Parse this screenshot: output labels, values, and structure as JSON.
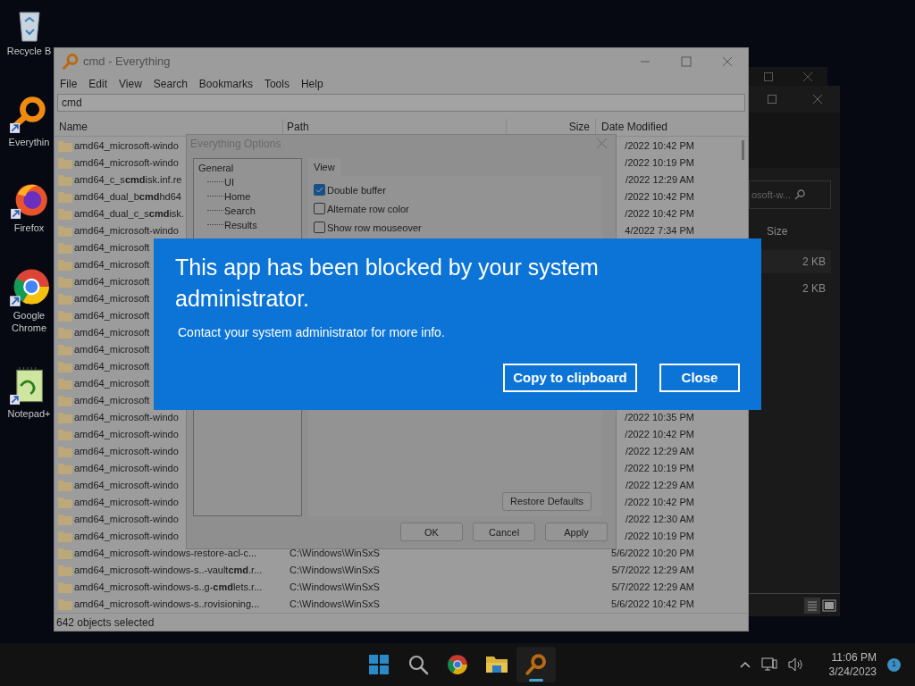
{
  "desktop_icons": [
    {
      "kind": "recycle",
      "label": "Recycle B"
    },
    {
      "kind": "everything",
      "label": "Everythin"
    },
    {
      "kind": "firefox",
      "label": "Firefox"
    },
    {
      "kind": "chrome",
      "label": "Google Chrome"
    },
    {
      "kind": "notepad",
      "label": "Notepad+"
    }
  ],
  "main_window": {
    "title": "cmd - Everything",
    "menu": [
      "File",
      "Edit",
      "View",
      "Search",
      "Bookmarks",
      "Tools",
      "Help"
    ],
    "search": {
      "value": "cmd"
    },
    "columns": [
      "Name",
      "Path",
      "Size",
      "Date Modified"
    ],
    "rows": [
      {
        "name": "amd64_microsoft-windo",
        "date": "/2022 10:42 PM"
      },
      {
        "name": "amd64_microsoft-windo",
        "date": "/2022 10:19 PM"
      },
      {
        "name": "amd64_c_s**cmd**isk.inf.re",
        "date": "/2022 12:29 AM"
      },
      {
        "name": "amd64_dual_b**cmd**hd64",
        "date": "/2022 10:42 PM"
      },
      {
        "name": "amd64_dual_c_s**cmd**isk.",
        "date": "/2022 10:42 PM"
      },
      {
        "name": "amd64_microsoft-windo",
        "date": "4/2022 7:34 PM"
      },
      {
        "name": "amd64_microsoft"
      },
      {
        "name": "amd64_microsoft"
      },
      {
        "name": "amd64_microsoft"
      },
      {
        "name": "amd64_microsoft"
      },
      {
        "name": "amd64_microsoft"
      },
      {
        "name": "amd64_microsoft"
      },
      {
        "name": "amd64_microsoft"
      },
      {
        "name": "amd64_microsoft"
      },
      {
        "name": "amd64_microsoft"
      },
      {
        "name": "amd64_microsoft"
      },
      {
        "name": "amd64_microsoft-windo",
        "date": "/2022 10:35 PM"
      },
      {
        "name": "amd64_microsoft-windo",
        "date": "/2022 10:42 PM"
      },
      {
        "name": "amd64_microsoft-windo",
        "date": "/2022 12:29 AM"
      },
      {
        "name": "amd64_microsoft-windo",
        "date": "/2022 10:19 PM"
      },
      {
        "name": "amd64_microsoft-windo",
        "date": "/2022 12:29 AM"
      },
      {
        "name": "amd64_microsoft-windo",
        "date": "/2022 10:42 PM"
      },
      {
        "name": "amd64_microsoft-windo",
        "date": "/2022 12:30 AM"
      },
      {
        "name": "amd64_microsoft-windo",
        "date": "/2022 10:19 PM"
      },
      {
        "name": "amd64_microsoft-windows-restore-acl-c...",
        "path": "C:\\Windows\\WinSxS",
        "date": "5/6/2022 10:20 PM"
      },
      {
        "name": "amd64_microsoft-windows-s..-vault**cmd**.r...",
        "path": "C:\\Windows\\WinSxS",
        "date": "5/7/2022 12:29 AM"
      },
      {
        "name": "amd64_microsoft-windows-s..g-**cmd**lets.r...",
        "path": "C:\\Windows\\WinSxS",
        "date": "5/7/2022 12:29 AM"
      },
      {
        "name": "amd64_microsoft-windows-s..rovisioning...",
        "path": "C:\\Windows\\WinSxS",
        "date": "5/6/2022 10:42 PM"
      }
    ],
    "status_bar": "642 objects selected"
  },
  "options_dialog": {
    "title": "Everything Options",
    "tree": [
      {
        "label": "General",
        "children": [
          {
            "label": "UI"
          },
          {
            "label": "Home"
          },
          {
            "label": "Search"
          },
          {
            "label": "Results"
          }
        ]
      }
    ],
    "tab": "View",
    "view_options": [
      {
        "label": "Double buffer",
        "checked": true
      },
      {
        "label": "Alternate row color",
        "checked": false
      },
      {
        "label": "Show row mouseover",
        "checked": false
      }
    ],
    "restore_button": "Restore Defaults",
    "buttons": [
      "OK",
      "Cancel",
      "Apply"
    ]
  },
  "blocked_dialog": {
    "title": "This app has been blocked by your system administrator.",
    "message": "Contact your system administrator for more info.",
    "buttons": [
      "Copy to clipboard",
      "Close"
    ]
  },
  "background_window": {
    "search": {
      "value": "osoft-w..."
    },
    "column": "Size",
    "sizes": [
      "2 KB",
      "2 KB"
    ]
  },
  "taskbar": {
    "apps": [
      {
        "kind": "start",
        "active": false
      },
      {
        "kind": "search",
        "active": false
      },
      {
        "kind": "chrome",
        "active": false
      },
      {
        "kind": "files",
        "active": false
      },
      {
        "kind": "everything",
        "active": true
      }
    ],
    "time": "11:06 PM",
    "date": "3/24/2023",
    "notifications": "1"
  }
}
